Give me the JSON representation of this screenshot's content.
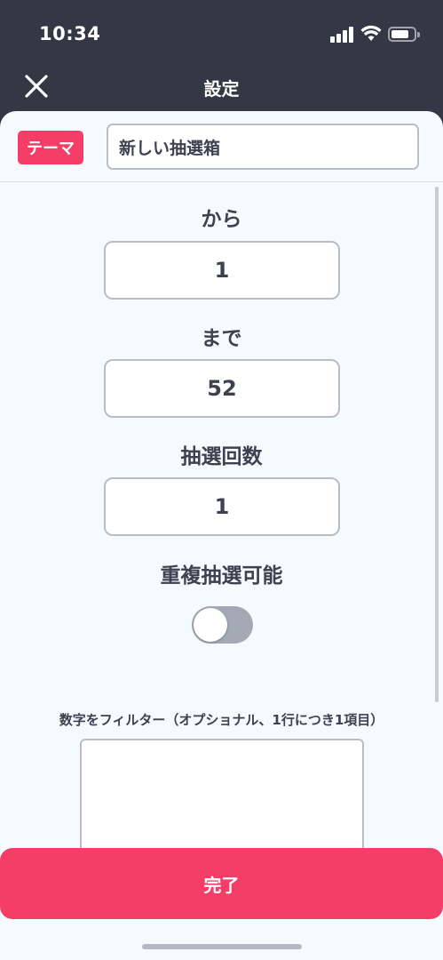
{
  "status": {
    "time": "10:34"
  },
  "header": {
    "title": "設定"
  },
  "theme": {
    "badge": "テーマ",
    "value": "新しい抽選箱"
  },
  "range": {
    "from_label": "から",
    "from_value": "1",
    "to_label": "まで",
    "to_value": "52"
  },
  "draw_count": {
    "label": "抽選回数",
    "value": "1"
  },
  "duplicate": {
    "label": "重複抽選可能",
    "enabled": false
  },
  "filter": {
    "label": "数字をフィルター（オプショナル、1行につき1項目）",
    "value": ""
  },
  "actions": {
    "done": "完了"
  },
  "colors": {
    "accent": "#f43e68",
    "header_bg": "#343744",
    "sheet_bg": "#f4fafd"
  }
}
